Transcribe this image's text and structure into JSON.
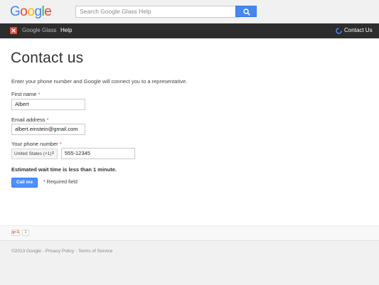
{
  "header": {
    "logo": [
      "G",
      "o",
      "o",
      "g",
      "l",
      "e"
    ],
    "search_placeholder": "Search Google Glass Help"
  },
  "nav": {
    "product": "Google Glass",
    "separator": "›",
    "section": "Help",
    "contact": "Contact Us"
  },
  "page": {
    "title": "Contact us",
    "intro": "Enter your phone number and Google will connect you to a representative."
  },
  "form": {
    "first_name_label": "First name",
    "first_name_value": "Albert",
    "email_label": "Email address",
    "email_value": "albert.einstein@gmail.com",
    "phone_label": "Your phone number",
    "country_value": "United States (+1)",
    "phone_value": "555-12345",
    "required_mark": "*",
    "wait_text": "Estimated wait time is less than 1 minute.",
    "call_button": "Call me",
    "required_note": "* Required field"
  },
  "plus": {
    "gplus_label": "g+1",
    "count": "1"
  },
  "footer": {
    "text": "©2013 Google - Privacy Policy - Terms of Service"
  },
  "colors": {
    "accent": "#4d90fe",
    "navbar": "#2d2d2d",
    "required": "#dd4b39"
  }
}
